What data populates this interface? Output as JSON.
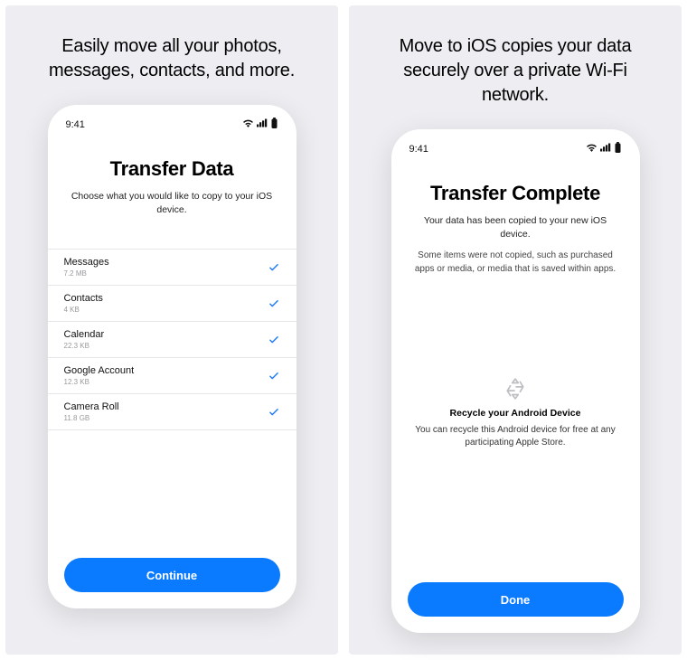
{
  "panels": [
    {
      "headline": "Easily move all your photos, messages, contacts, and more."
    },
    {
      "headline": "Move to iOS copies your data securely over a private Wi-Fi network."
    }
  ],
  "status": {
    "time": "9:41"
  },
  "screen1": {
    "title": "Transfer Data",
    "subtitle": "Choose what you would like to copy to your iOS device.",
    "items": [
      {
        "label": "Messages",
        "size": "7.2 MB",
        "checked": true
      },
      {
        "label": "Contacts",
        "size": "4 KB",
        "checked": true
      },
      {
        "label": "Calendar",
        "size": "22.3 KB",
        "checked": true
      },
      {
        "label": "Google Account",
        "size": "12.3 KB",
        "checked": true
      },
      {
        "label": "Camera Roll",
        "size": "11.8 GB",
        "checked": true
      }
    ],
    "button": "Continue"
  },
  "screen2": {
    "title": "Transfer Complete",
    "subtitle": "Your data has been copied to your new iOS device.",
    "note": "Some items were not copied, such as purchased apps or media, or media that is saved within apps.",
    "recycle": {
      "title": "Recycle your Android Device",
      "desc": "You can recycle this Android device for free at any participating Apple Store."
    },
    "button": "Done"
  }
}
